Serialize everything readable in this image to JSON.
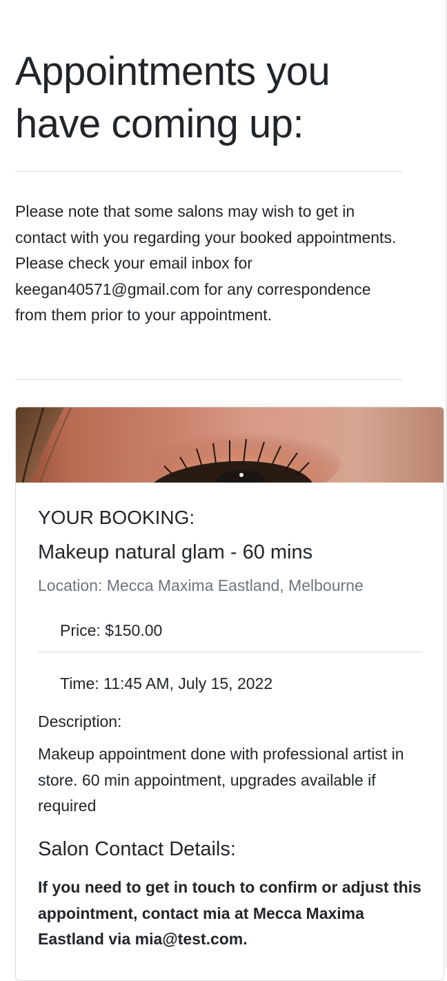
{
  "page": {
    "title": "Appointments you have coming up:",
    "notice": "Please note that some salons may wish to get in contact with you regarding your booked appointments. Please check your email inbox for keegan40571@gmail.com for any correspondence from them prior to your appointment."
  },
  "booking": {
    "heading": "YOUR BOOKING:",
    "service": "Makeup natural glam - 60 mins",
    "location": "Location: Mecca Maxima Eastland, Melbourne",
    "price": "Price: $150.00",
    "time": "Time: 11:45 AM, July 15, 2022",
    "description_label": "Description:",
    "description": "Makeup appointment done with professional artist in store. 60 min appointment, upgrades available if required",
    "contact_heading": "Salon Contact Details:",
    "contact_text": "If you need to get in touch to confirm or adjust this appointment, contact mia at Mecca Maxima Eastland via mia@test.com.",
    "image_icon": "eye-makeup-photo"
  },
  "colors": {
    "text": "#212529",
    "muted": "#6c757d",
    "divider": "#d8d8d8"
  }
}
